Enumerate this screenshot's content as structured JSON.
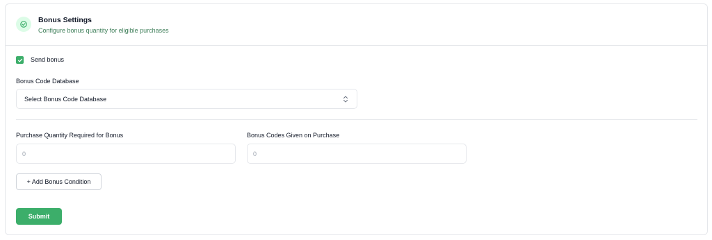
{
  "header": {
    "title": "Bonus Settings",
    "subtitle": "Configure bonus quantity for eligible purchases",
    "icon": "clock-check-icon"
  },
  "send_bonus": {
    "label": "Send bonus",
    "checked": true
  },
  "bonus_code_database": {
    "label": "Bonus Code Database",
    "selected": "Select Bonus Code Database"
  },
  "purchase_quantity": {
    "label": "Purchase Quantity Required for Bonus",
    "placeholder": "0"
  },
  "bonus_codes_given": {
    "label": "Bonus Codes Given on Purchase",
    "placeholder": "0"
  },
  "add_condition_label": "+ Add Bonus Condition",
  "submit_label": "Submit",
  "colors": {
    "accent": "#3cae6a",
    "icon_bg": "#dcfce7",
    "subtitle": "#3f7f5a",
    "border": "#e5e7eb"
  }
}
